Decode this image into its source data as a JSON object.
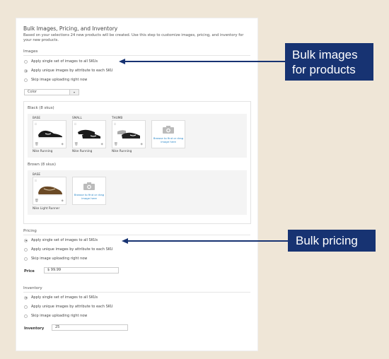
{
  "panel": {
    "title": "Bulk Images, Pricing, and Inventory",
    "description": "Based on your selections 24 new products will be created. Use this step to customize images, pricing, and inventory for your new products."
  },
  "images": {
    "label": "Images",
    "options": [
      {
        "label": "Apply single set of images to all SKUs",
        "selected": false
      },
      {
        "label": "Apply unique images by attribute to each SKU",
        "selected": true
      },
      {
        "label": "Skip image uploading right now",
        "selected": false
      }
    ],
    "attribute_select": {
      "value": "Color",
      "caret": "▾"
    },
    "groups": [
      {
        "label": "Black (8 skus)",
        "tiles": [
          {
            "role": "BASE",
            "caption": "Nike Running",
            "color": "#1a1a1a"
          },
          {
            "role": "SMALL",
            "caption": "Nike Running",
            "color": "#1a1a1a"
          },
          {
            "role": "THUMB",
            "caption": "Nike Running",
            "color": "#2a2a2a"
          }
        ],
        "upload_text": "Browse to find or drag image here"
      },
      {
        "label": "Brown (8 skus)",
        "tiles": [
          {
            "role": "BASE",
            "caption": "Nike Light Runner",
            "color": "#6b4a26"
          }
        ],
        "upload_text": "Browse to find or drag image here"
      }
    ]
  },
  "pricing": {
    "label": "Pricing",
    "options": [
      {
        "label": "Apply single set of images to all SKUs",
        "selected": true
      },
      {
        "label": "Apply unique images by attribute to each SKU",
        "selected": false
      },
      {
        "label": "Skip image uploading right now",
        "selected": false
      }
    ],
    "field_label": "Price",
    "field_value": "$  99.99"
  },
  "inventory": {
    "label": "Inventory",
    "options": [
      {
        "label": "Apply single set of images to all SKUs",
        "selected": true
      },
      {
        "label": "Apply unique images by attribute to each SKU",
        "selected": false
      },
      {
        "label": "Skip image uploading right now",
        "selected": false
      }
    ],
    "field_label": "Inventory",
    "field_value": "25"
  },
  "callouts": {
    "images": "Bulk images for products",
    "images_line1": "Bulk images",
    "images_line2": "for products",
    "pricing": "Bulk pricing"
  },
  "colors": {
    "callout_bg": "#173372",
    "background": "#efe6d7",
    "link": "#2a87c8"
  }
}
